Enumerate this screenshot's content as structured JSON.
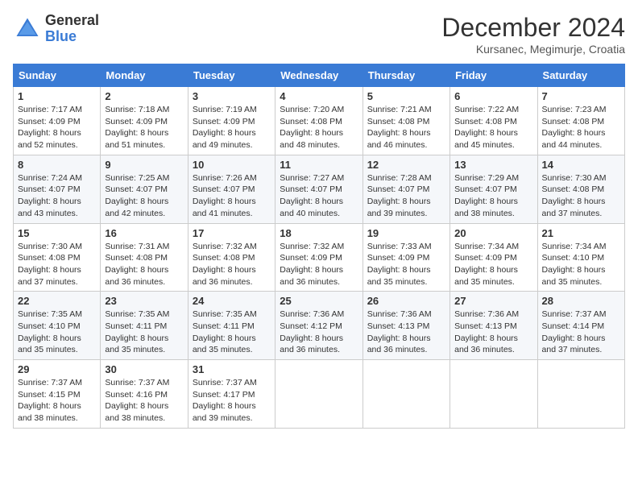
{
  "header": {
    "logo_general": "General",
    "logo_blue": "Blue",
    "month_title": "December 2024",
    "location": "Kursanec, Megimurje, Croatia"
  },
  "calendar": {
    "weekdays": [
      "Sunday",
      "Monday",
      "Tuesday",
      "Wednesday",
      "Thursday",
      "Friday",
      "Saturday"
    ],
    "weeks": [
      [
        {
          "day": "1",
          "sunrise": "7:17 AM",
          "sunset": "4:09 PM",
          "daylight": "8 hours and 52 minutes."
        },
        {
          "day": "2",
          "sunrise": "7:18 AM",
          "sunset": "4:09 PM",
          "daylight": "8 hours and 51 minutes."
        },
        {
          "day": "3",
          "sunrise": "7:19 AM",
          "sunset": "4:09 PM",
          "daylight": "8 hours and 49 minutes."
        },
        {
          "day": "4",
          "sunrise": "7:20 AM",
          "sunset": "4:08 PM",
          "daylight": "8 hours and 48 minutes."
        },
        {
          "day": "5",
          "sunrise": "7:21 AM",
          "sunset": "4:08 PM",
          "daylight": "8 hours and 46 minutes."
        },
        {
          "day": "6",
          "sunrise": "7:22 AM",
          "sunset": "4:08 PM",
          "daylight": "8 hours and 45 minutes."
        },
        {
          "day": "7",
          "sunrise": "7:23 AM",
          "sunset": "4:08 PM",
          "daylight": "8 hours and 44 minutes."
        }
      ],
      [
        {
          "day": "8",
          "sunrise": "7:24 AM",
          "sunset": "4:07 PM",
          "daylight": "8 hours and 43 minutes."
        },
        {
          "day": "9",
          "sunrise": "7:25 AM",
          "sunset": "4:07 PM",
          "daylight": "8 hours and 42 minutes."
        },
        {
          "day": "10",
          "sunrise": "7:26 AM",
          "sunset": "4:07 PM",
          "daylight": "8 hours and 41 minutes."
        },
        {
          "day": "11",
          "sunrise": "7:27 AM",
          "sunset": "4:07 PM",
          "daylight": "8 hours and 40 minutes."
        },
        {
          "day": "12",
          "sunrise": "7:28 AM",
          "sunset": "4:07 PM",
          "daylight": "8 hours and 39 minutes."
        },
        {
          "day": "13",
          "sunrise": "7:29 AM",
          "sunset": "4:07 PM",
          "daylight": "8 hours and 38 minutes."
        },
        {
          "day": "14",
          "sunrise": "7:30 AM",
          "sunset": "4:08 PM",
          "daylight": "8 hours and 37 minutes."
        }
      ],
      [
        {
          "day": "15",
          "sunrise": "7:30 AM",
          "sunset": "4:08 PM",
          "daylight": "8 hours and 37 minutes."
        },
        {
          "day": "16",
          "sunrise": "7:31 AM",
          "sunset": "4:08 PM",
          "daylight": "8 hours and 36 minutes."
        },
        {
          "day": "17",
          "sunrise": "7:32 AM",
          "sunset": "4:08 PM",
          "daylight": "8 hours and 36 minutes."
        },
        {
          "day": "18",
          "sunrise": "7:32 AM",
          "sunset": "4:09 PM",
          "daylight": "8 hours and 36 minutes."
        },
        {
          "day": "19",
          "sunrise": "7:33 AM",
          "sunset": "4:09 PM",
          "daylight": "8 hours and 35 minutes."
        },
        {
          "day": "20",
          "sunrise": "7:34 AM",
          "sunset": "4:09 PM",
          "daylight": "8 hours and 35 minutes."
        },
        {
          "day": "21",
          "sunrise": "7:34 AM",
          "sunset": "4:10 PM",
          "daylight": "8 hours and 35 minutes."
        }
      ],
      [
        {
          "day": "22",
          "sunrise": "7:35 AM",
          "sunset": "4:10 PM",
          "daylight": "8 hours and 35 minutes."
        },
        {
          "day": "23",
          "sunrise": "7:35 AM",
          "sunset": "4:11 PM",
          "daylight": "8 hours and 35 minutes."
        },
        {
          "day": "24",
          "sunrise": "7:35 AM",
          "sunset": "4:11 PM",
          "daylight": "8 hours and 35 minutes."
        },
        {
          "day": "25",
          "sunrise": "7:36 AM",
          "sunset": "4:12 PM",
          "daylight": "8 hours and 36 minutes."
        },
        {
          "day": "26",
          "sunrise": "7:36 AM",
          "sunset": "4:13 PM",
          "daylight": "8 hours and 36 minutes."
        },
        {
          "day": "27",
          "sunrise": "7:36 AM",
          "sunset": "4:13 PM",
          "daylight": "8 hours and 36 minutes."
        },
        {
          "day": "28",
          "sunrise": "7:37 AM",
          "sunset": "4:14 PM",
          "daylight": "8 hours and 37 minutes."
        }
      ],
      [
        {
          "day": "29",
          "sunrise": "7:37 AM",
          "sunset": "4:15 PM",
          "daylight": "8 hours and 38 minutes."
        },
        {
          "day": "30",
          "sunrise": "7:37 AM",
          "sunset": "4:16 PM",
          "daylight": "8 hours and 38 minutes."
        },
        {
          "day": "31",
          "sunrise": "7:37 AM",
          "sunset": "4:17 PM",
          "daylight": "8 hours and 39 minutes."
        },
        null,
        null,
        null,
        null
      ]
    ]
  }
}
